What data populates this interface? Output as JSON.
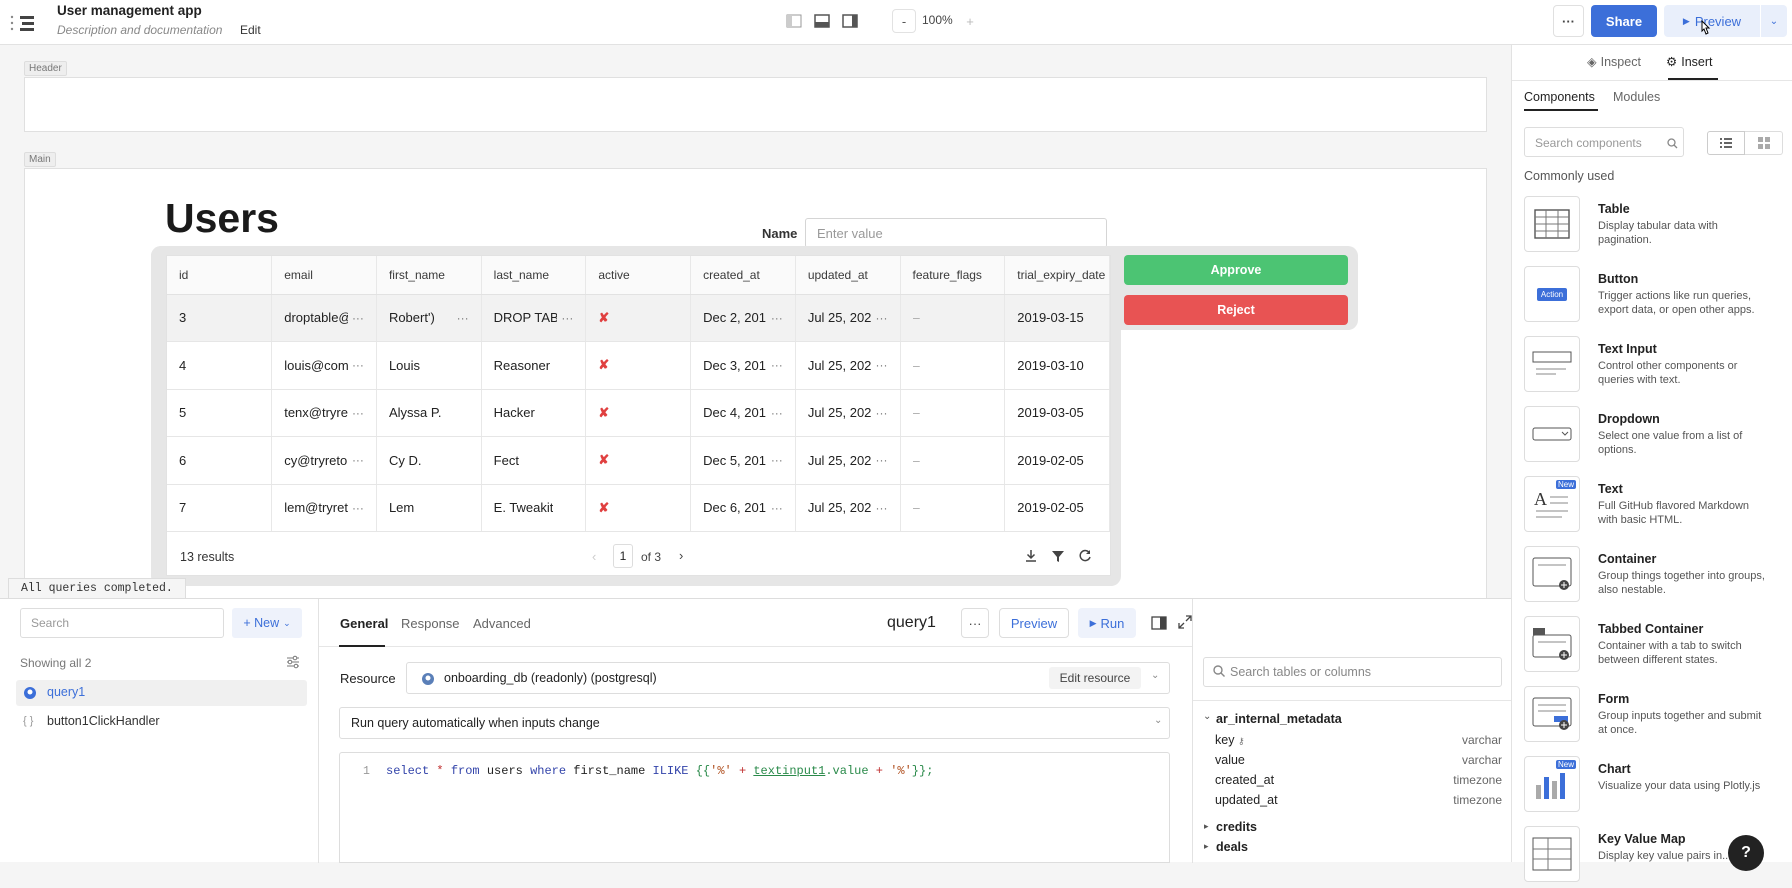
{
  "app": {
    "title": "User management app",
    "subtitle": "Description and documentation",
    "edit_label": "Edit"
  },
  "toolbar": {
    "zoom_minus": "-",
    "zoom_level": "100%",
    "zoom_plus": "+",
    "more": "···",
    "share_label": "Share",
    "preview_label": "Preview"
  },
  "canvas": {
    "header_label": "Header",
    "main_label": "Main",
    "page_heading": "Users",
    "name_label": "Name",
    "name_placeholder": "Enter value",
    "approve_label": "Approve",
    "reject_label": "Reject"
  },
  "table": {
    "columns": [
      "id",
      "email",
      "first_name",
      "last_name",
      "active",
      "created_at",
      "updated_at",
      "feature_flags",
      "trial_expiry_date"
    ],
    "rows": [
      [
        "3",
        "droptable@",
        "Robert')",
        "DROP TABL",
        "✘",
        "Dec 2, 201",
        "Jul 25, 202",
        "–",
        "2019-03-15"
      ],
      [
        "4",
        "louis@com",
        "Louis",
        "Reasoner",
        "✘",
        "Dec 3, 201",
        "Jul 25, 202",
        "–",
        "2019-03-10"
      ],
      [
        "5",
        "tenx@tryre",
        "Alyssa P.",
        "Hacker",
        "✘",
        "Dec 4, 201",
        "Jul 25, 202",
        "–",
        "2019-03-05"
      ],
      [
        "6",
        "cy@tryreto",
        "Cy D.",
        "Fect",
        "✘",
        "Dec 5, 201",
        "Jul 25, 202",
        "–",
        "2019-02-05"
      ],
      [
        "7",
        "lem@tryret",
        "Lem",
        "E. Tweakit",
        "✘",
        "Dec 6, 201",
        "Jul 25, 202",
        "–",
        "2019-02-05"
      ]
    ],
    "results": "13 results",
    "page": "1",
    "of_pages": "of 3"
  },
  "status": "All queries completed.",
  "query_list": {
    "search_placeholder": "Search",
    "new_label": "+ New",
    "showing": "Showing all 2",
    "items": [
      "query1",
      "button1ClickHandler"
    ]
  },
  "editor": {
    "tabs": [
      "General",
      "Response",
      "Advanced"
    ],
    "query_name": "query1",
    "more": "···",
    "preview_label": "Preview",
    "run_label": "Run",
    "resource_label": "Resource",
    "resource_value": "onboarding_db (readonly) (postgresql)",
    "edit_resource": "Edit resource",
    "trigger": "Run query automatically when inputs change",
    "line_no": "1",
    "sql": {
      "kw1": "select",
      "star": "*",
      "kw2": "from",
      "tbl": "users",
      "kw3": "where",
      "col": "first_name",
      "kw4": "ILIKE",
      "open": "{{",
      "s1": "'%'",
      "plus1": "+",
      "ref": "textinput1",
      "prop": ".value",
      "plus2": "+",
      "s2": "'%'",
      "close": "}};"
    }
  },
  "schema": {
    "search_placeholder": "Search tables or columns",
    "table1": "ar_internal_metadata",
    "columns": [
      {
        "name": "key",
        "type": "varchar"
      },
      {
        "name": "value",
        "type": "varchar"
      },
      {
        "name": "created_at",
        "type": "timezone"
      },
      {
        "name": "updated_at",
        "type": "timezone"
      }
    ],
    "others": [
      "credits",
      "deals"
    ]
  },
  "right_panel": {
    "tabs": [
      "Inspect",
      "Insert"
    ],
    "subtabs": [
      "Components",
      "Modules"
    ],
    "search_placeholder": "Search components",
    "section": "Commonly used",
    "components": [
      {
        "title": "Table",
        "desc": "Display tabular data with pagination."
      },
      {
        "title": "Button",
        "desc": "Trigger actions like run queries, export data, or open other apps.",
        "thumb_text": "Action"
      },
      {
        "title": "Text Input",
        "desc": "Control other components or queries with text."
      },
      {
        "title": "Dropdown",
        "desc": "Select one value from a list of options."
      },
      {
        "title": "Text",
        "desc": "Full GitHub flavored Markdown with basic HTML.",
        "badge": "New"
      },
      {
        "title": "Container",
        "desc": "Group things together into groups, also nestable."
      },
      {
        "title": "Tabbed Container",
        "desc": "Container with a tab to switch between different states."
      },
      {
        "title": "Form",
        "desc": "Group inputs together and submit at once."
      },
      {
        "title": "Chart",
        "desc": "Visualize your data using Plotly.js",
        "badge": "New"
      },
      {
        "title": "Key Value Map",
        "desc": "Display key value pairs in..."
      }
    ]
  },
  "colors": {
    "primary": "#3c6fd9",
    "approve": "#4cc473",
    "reject": "#e85353",
    "danger": "#e04040"
  }
}
